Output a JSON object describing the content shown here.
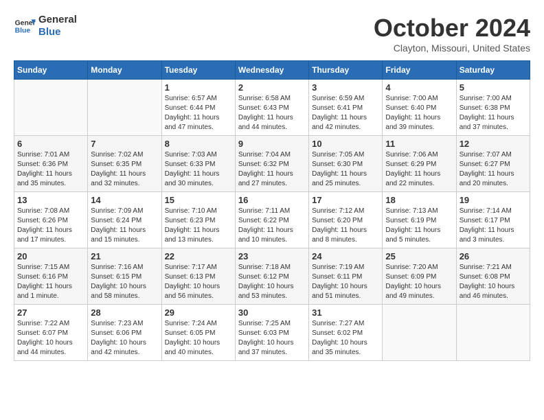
{
  "header": {
    "logo_line1": "General",
    "logo_line2": "Blue",
    "month": "October 2024",
    "location": "Clayton, Missouri, United States"
  },
  "weekdays": [
    "Sunday",
    "Monday",
    "Tuesday",
    "Wednesday",
    "Thursday",
    "Friday",
    "Saturday"
  ],
  "weeks": [
    [
      {
        "day": "",
        "info": ""
      },
      {
        "day": "",
        "info": ""
      },
      {
        "day": "1",
        "info": "Sunrise: 6:57 AM\nSunset: 6:44 PM\nDaylight: 11 hours and 47 minutes."
      },
      {
        "day": "2",
        "info": "Sunrise: 6:58 AM\nSunset: 6:43 PM\nDaylight: 11 hours and 44 minutes."
      },
      {
        "day": "3",
        "info": "Sunrise: 6:59 AM\nSunset: 6:41 PM\nDaylight: 11 hours and 42 minutes."
      },
      {
        "day": "4",
        "info": "Sunrise: 7:00 AM\nSunset: 6:40 PM\nDaylight: 11 hours and 39 minutes."
      },
      {
        "day": "5",
        "info": "Sunrise: 7:00 AM\nSunset: 6:38 PM\nDaylight: 11 hours and 37 minutes."
      }
    ],
    [
      {
        "day": "6",
        "info": "Sunrise: 7:01 AM\nSunset: 6:36 PM\nDaylight: 11 hours and 35 minutes."
      },
      {
        "day": "7",
        "info": "Sunrise: 7:02 AM\nSunset: 6:35 PM\nDaylight: 11 hours and 32 minutes."
      },
      {
        "day": "8",
        "info": "Sunrise: 7:03 AM\nSunset: 6:33 PM\nDaylight: 11 hours and 30 minutes."
      },
      {
        "day": "9",
        "info": "Sunrise: 7:04 AM\nSunset: 6:32 PM\nDaylight: 11 hours and 27 minutes."
      },
      {
        "day": "10",
        "info": "Sunrise: 7:05 AM\nSunset: 6:30 PM\nDaylight: 11 hours and 25 minutes."
      },
      {
        "day": "11",
        "info": "Sunrise: 7:06 AM\nSunset: 6:29 PM\nDaylight: 11 hours and 22 minutes."
      },
      {
        "day": "12",
        "info": "Sunrise: 7:07 AM\nSunset: 6:27 PM\nDaylight: 11 hours and 20 minutes."
      }
    ],
    [
      {
        "day": "13",
        "info": "Sunrise: 7:08 AM\nSunset: 6:26 PM\nDaylight: 11 hours and 17 minutes."
      },
      {
        "day": "14",
        "info": "Sunrise: 7:09 AM\nSunset: 6:24 PM\nDaylight: 11 hours and 15 minutes."
      },
      {
        "day": "15",
        "info": "Sunrise: 7:10 AM\nSunset: 6:23 PM\nDaylight: 11 hours and 13 minutes."
      },
      {
        "day": "16",
        "info": "Sunrise: 7:11 AM\nSunset: 6:22 PM\nDaylight: 11 hours and 10 minutes."
      },
      {
        "day": "17",
        "info": "Sunrise: 7:12 AM\nSunset: 6:20 PM\nDaylight: 11 hours and 8 minutes."
      },
      {
        "day": "18",
        "info": "Sunrise: 7:13 AM\nSunset: 6:19 PM\nDaylight: 11 hours and 5 minutes."
      },
      {
        "day": "19",
        "info": "Sunrise: 7:14 AM\nSunset: 6:17 PM\nDaylight: 11 hours and 3 minutes."
      }
    ],
    [
      {
        "day": "20",
        "info": "Sunrise: 7:15 AM\nSunset: 6:16 PM\nDaylight: 11 hours and 1 minute."
      },
      {
        "day": "21",
        "info": "Sunrise: 7:16 AM\nSunset: 6:15 PM\nDaylight: 10 hours and 58 minutes."
      },
      {
        "day": "22",
        "info": "Sunrise: 7:17 AM\nSunset: 6:13 PM\nDaylight: 10 hours and 56 minutes."
      },
      {
        "day": "23",
        "info": "Sunrise: 7:18 AM\nSunset: 6:12 PM\nDaylight: 10 hours and 53 minutes."
      },
      {
        "day": "24",
        "info": "Sunrise: 7:19 AM\nSunset: 6:11 PM\nDaylight: 10 hours and 51 minutes."
      },
      {
        "day": "25",
        "info": "Sunrise: 7:20 AM\nSunset: 6:09 PM\nDaylight: 10 hours and 49 minutes."
      },
      {
        "day": "26",
        "info": "Sunrise: 7:21 AM\nSunset: 6:08 PM\nDaylight: 10 hours and 46 minutes."
      }
    ],
    [
      {
        "day": "27",
        "info": "Sunrise: 7:22 AM\nSunset: 6:07 PM\nDaylight: 10 hours and 44 minutes."
      },
      {
        "day": "28",
        "info": "Sunrise: 7:23 AM\nSunset: 6:06 PM\nDaylight: 10 hours and 42 minutes."
      },
      {
        "day": "29",
        "info": "Sunrise: 7:24 AM\nSunset: 6:05 PM\nDaylight: 10 hours and 40 minutes."
      },
      {
        "day": "30",
        "info": "Sunrise: 7:25 AM\nSunset: 6:03 PM\nDaylight: 10 hours and 37 minutes."
      },
      {
        "day": "31",
        "info": "Sunrise: 7:27 AM\nSunset: 6:02 PM\nDaylight: 10 hours and 35 minutes."
      },
      {
        "day": "",
        "info": ""
      },
      {
        "day": "",
        "info": ""
      }
    ]
  ]
}
